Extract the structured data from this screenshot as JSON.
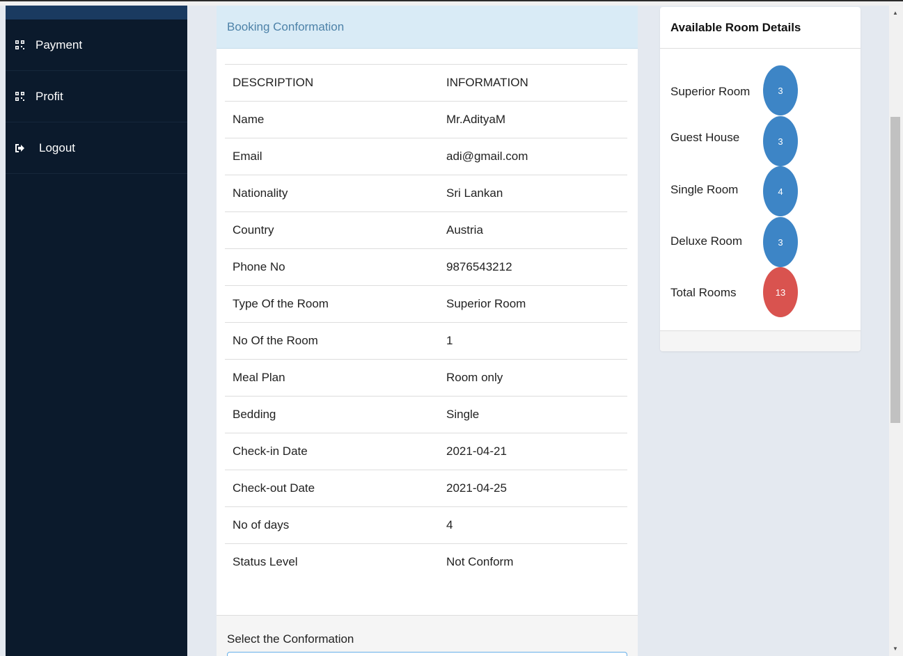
{
  "sidebar": {
    "items": [
      {
        "label": "Payment",
        "icon": "qr-grid-icon"
      },
      {
        "label": "Profit",
        "icon": "qr-grid-icon"
      },
      {
        "label": "Logout",
        "icon": "logout-icon"
      }
    ]
  },
  "booking": {
    "heading": "Booking Conformation",
    "columns": {
      "description": "DESCRIPTION",
      "information": "INFORMATION"
    },
    "rows": [
      {
        "label": "Name",
        "value": "Mr.AdityaM"
      },
      {
        "label": "Email",
        "value": "adi@gmail.com"
      },
      {
        "label": "Nationality",
        "value": "Sri Lankan"
      },
      {
        "label": "Country",
        "value": "Austria"
      },
      {
        "label": "Phone No",
        "value": "9876543212"
      },
      {
        "label": "Type Of the Room",
        "value": "Superior Room"
      },
      {
        "label": "No Of the Room",
        "value": "1"
      },
      {
        "label": "Meal Plan",
        "value": "Room only"
      },
      {
        "label": "Bedding",
        "value": "Single"
      },
      {
        "label": "Check-in Date",
        "value": "2021-04-21"
      },
      {
        "label": "Check-out Date",
        "value": "2021-04-25"
      },
      {
        "label": "No of days",
        "value": "4"
      },
      {
        "label": "Status Level",
        "value": "Not Conform"
      }
    ],
    "footer_label": "Select the Conformation"
  },
  "rooms": {
    "heading": "Available Room Details",
    "items": [
      {
        "label": "Superior Room",
        "count": "3",
        "color": "#3d85c6"
      },
      {
        "label": "Guest House",
        "count": "3",
        "color": "#3d85c6"
      },
      {
        "label": "Single Room",
        "count": "4",
        "color": "#3d85c6"
      },
      {
        "label": "Deluxe Room",
        "count": "3",
        "color": "#3d85c6"
      },
      {
        "label": "Total Rooms",
        "count": "13",
        "color": "#d9534f"
      }
    ]
  },
  "colors": {
    "sidebar_bg": "#0b1a2c",
    "panel_heading_bg": "#d9ebf6",
    "panel_heading_text": "#4d82a8",
    "badge_blue": "#3d85c6",
    "badge_red": "#d9534f"
  }
}
